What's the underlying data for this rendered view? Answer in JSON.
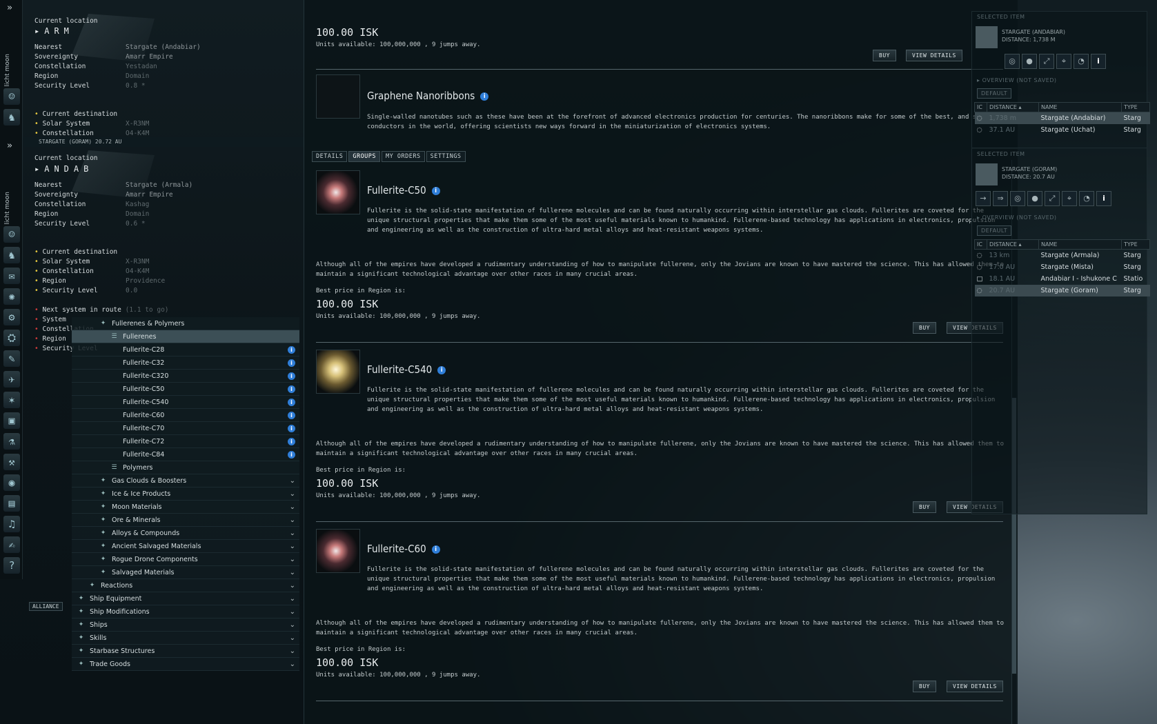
{
  "neocom": {
    "vertical_labels": [
      "licht moon",
      "licht moon"
    ],
    "icons": [
      "character-icon",
      "skills-icon",
      "mail-icon",
      "chat-icon",
      "market-icon",
      "industry-icon",
      "science-icon",
      "map-icon",
      "starmap-icon",
      "cargo-icon",
      "corporation-icon",
      "people-icon",
      "wallet-icon",
      "journal-icon",
      "fitting-icon",
      "notepad-icon",
      "help-icon"
    ]
  },
  "location_top": {
    "current_location_label": "Current location",
    "system_name": "ARM",
    "rows": [
      {
        "label": "Nearest",
        "value": "Stargate (Andabiar)"
      },
      {
        "label": "Sovereignty",
        "value": "Amarr Empire"
      },
      {
        "label": "Constellation",
        "value": "Yestadan"
      },
      {
        "label": "Region",
        "value": "Domain"
      },
      {
        "label": "Security Level",
        "value": "0.8 *"
      }
    ],
    "route": [
      {
        "label": "Current destination",
        "value": ""
      },
      {
        "label": "Solar System",
        "value": "X-R3NM"
      },
      {
        "label": "Constellation",
        "value": "O4-K4M"
      }
    ]
  },
  "location_bar": {
    "text": "STARGATE (GORAM)     20.72 AU"
  },
  "location_bottom": {
    "current_location_label": "Current location",
    "system_name": "ANDAB",
    "rows": [
      {
        "label": "Nearest",
        "value": "Stargate (Armala)"
      },
      {
        "label": "Sovereignty",
        "value": "Amarr Empire"
      },
      {
        "label": "Constellation",
        "value": "Kashag"
      },
      {
        "label": "Region",
        "value": "Domain"
      },
      {
        "label": "Security Level",
        "value": "0.6 *"
      }
    ],
    "route": [
      {
        "label": "Current destination",
        "value": ""
      },
      {
        "label": "Solar System",
        "value": "X-R3NM"
      },
      {
        "label": "Constellation",
        "value": "O4-K4M"
      },
      {
        "label": "Region",
        "value": "Providence"
      },
      {
        "label": "Security Level",
        "value": "0.0"
      }
    ],
    "next": [
      {
        "label": "Next system in route",
        "value": "(1.1 to go)"
      },
      {
        "label": "System",
        "value": ""
      },
      {
        "label": "Constellation",
        "value": ""
      },
      {
        "label": "Region",
        "value": ""
      },
      {
        "label": "Security Level",
        "value": ""
      }
    ]
  },
  "market_tree": {
    "items": [
      {
        "label": "Fullerenes & Polymers",
        "level": 2,
        "kind": "group"
      },
      {
        "label": "Fullerenes",
        "level": 3,
        "kind": "list",
        "selected": true
      },
      {
        "label": "Fullerite-C28",
        "level": 4,
        "kind": "item"
      },
      {
        "label": "Fullerite-C32",
        "level": 4,
        "kind": "item"
      },
      {
        "label": "Fullerite-C320",
        "level": 4,
        "kind": "item"
      },
      {
        "label": "Fullerite-C50",
        "level": 4,
        "kind": "item"
      },
      {
        "label": "Fullerite-C540",
        "level": 4,
        "kind": "item"
      },
      {
        "label": "Fullerite-C60",
        "level": 4,
        "kind": "item"
      },
      {
        "label": "Fullerite-C70",
        "level": 4,
        "kind": "item"
      },
      {
        "label": "Fullerite-C72",
        "level": 4,
        "kind": "item"
      },
      {
        "label": "Fullerite-C84",
        "level": 4,
        "kind": "item"
      },
      {
        "label": "Polymers",
        "level": 3,
        "kind": "list"
      },
      {
        "label": "Gas Clouds & Boosters",
        "level": 2,
        "kind": "group",
        "expandable": true
      },
      {
        "label": "Ice & Ice Products",
        "level": 2,
        "kind": "group",
        "expandable": true
      },
      {
        "label": "Moon Materials",
        "level": 2,
        "kind": "group",
        "expandable": true
      },
      {
        "label": "Ore & Minerals",
        "level": 2,
        "kind": "group",
        "expandable": true
      },
      {
        "label": "Alloys & Compounds",
        "level": 2,
        "kind": "group",
        "expandable": true
      },
      {
        "label": "Ancient Salvaged Materials",
        "level": 2,
        "kind": "group",
        "expandable": true
      },
      {
        "label": "Rogue Drone Components",
        "level": 2,
        "kind": "group",
        "expandable": true
      },
      {
        "label": "Salvaged Materials",
        "level": 2,
        "kind": "group",
        "expandable": true
      },
      {
        "label": "Reactions",
        "level": 1,
        "kind": "group",
        "expandable": true
      },
      {
        "label": "Ship Equipment",
        "level": 0,
        "kind": "group",
        "expandable": true
      },
      {
        "label": "Ship Modifications",
        "level": 0,
        "kind": "group",
        "expandable": true
      },
      {
        "label": "Ships",
        "level": 0,
        "kind": "group",
        "expandable": true
      },
      {
        "label": "Skills",
        "level": 0,
        "kind": "group",
        "expandable": true
      },
      {
        "label": "Starbase Structures",
        "level": 0,
        "kind": "group",
        "expandable": true
      },
      {
        "label": "Trade Goods",
        "level": 0,
        "kind": "group",
        "expandable": true
      }
    ]
  },
  "market_top": {
    "price": "100.00 ISK",
    "units": "Units available: 100,000,000 , 9 jumps away.",
    "buy": "BUY",
    "view_details": "VIEW DETAILS",
    "item_name": "Graphene Nanoribbons",
    "item_desc": "Single-walled nanotubes such as these have been at the forefront of advanced electronics production for centuries. The nanoribbons make for some of the best, and smallest, conductors in the world, offering scientists new ways forward in the miniaturization of electronics systems."
  },
  "tabs": [
    "DETAILS",
    "GROUPS",
    "MY ORDERS",
    "SETTINGS"
  ],
  "items": [
    {
      "name": "Fullerite-C50",
      "desc1": "Fullerite is the solid-state manifestation of fullerene molecules and can be found naturally occurring within interstellar gas clouds. Fullerites are coveted for the unique structural properties that make them some of the most useful materials known to humankind. Fullerene-based technology has applications in electronics, propulsion and engineering as well as the construction of ultra-hard metal alloys and heat-resistant weapons systems.",
      "desc2": "Although all of the empires have developed a rudimentary understanding of how to manipulate fullerene, only the Jovians are known to have mastered the science. This has allowed them to maintain a significant technological advantage over other races in many crucial areas.",
      "price_label": "Best price in Region is:",
      "price": "100.00 ISK",
      "units": "Units available: 100,000,000 , 9 jumps away.",
      "buy": "BUY",
      "view_details": "VIEW DETAILS"
    },
    {
      "name": "Fullerite-C540",
      "desc1": "Fullerite is the solid-state manifestation of fullerene molecules and can be found naturally occurring within interstellar gas clouds. Fullerites are coveted for the unique structural properties that make them some of the most useful materials known to humankind. Fullerene-based technology has applications in electronics, propulsion and engineering as well as the construction of ultra-hard metal alloys and heat-resistant weapons systems.",
      "desc2": "Although all of the empires have developed a rudimentary understanding of how to manipulate fullerene, only the Jovians are known to have mastered the science. This has allowed them to maintain a significant technological advantage over other races in many crucial areas.",
      "price_label": "Best price in Region is:",
      "price": "100.00 ISK",
      "units": "Units available: 100,000,000 , 9 jumps away.",
      "buy": "BUY",
      "view_details": "VIEW DETAILS"
    },
    {
      "name": "Fullerite-C60",
      "desc1": "Fullerite is the solid-state manifestation of fullerene molecules and can be found naturally occurring within interstellar gas clouds. Fullerites are coveted for the unique structural properties that make them some of the most useful materials known to humankind. Fullerene-based technology has applications in electronics, propulsion and engineering as well as the construction of ultra-hard metal alloys and heat-resistant weapons systems.",
      "desc2": "Although all of the empires have developed a rudimentary understanding of how to manipulate fullerene, only the Jovians are known to have mastered the science. This has allowed them to maintain a significant technological advantage over other races in many crucial areas.",
      "price_label": "Best price in Region is:",
      "price": "100.00 ISK",
      "units": "Units available: 100,000,000 , 9 jumps away.",
      "buy": "BUY",
      "view_details": "VIEW DETAILS"
    }
  ],
  "overview_top": {
    "selected_item": "SELECTED ITEM",
    "sel_name": "STARGATE (ANDABIAR)",
    "sel_dist": "DISTANCE: 1,738 M",
    "overview_title": "OVERVIEW (NOT SAVED)",
    "tab": "DEFAULT",
    "columns": [
      "IC",
      "DISTANCE",
      "NAME",
      "TYPE"
    ],
    "rows": [
      {
        "dist": "1,738 m",
        "name": "Stargate (Andabiar)",
        "type": "Starg"
      },
      {
        "dist": "37.1 AU",
        "name": "Stargate (Uchat)",
        "type": "Starg"
      }
    ]
  },
  "overview_bottom": {
    "selected_item": "SELECTED ITEM",
    "sel_name": "STARGATE (GORAM)",
    "sel_dist": "DISTANCE: 20.7 AU",
    "overview_title": "OVERVIEW (NOT SAVED)",
    "tab": "DEFAULT",
    "columns": [
      "IC",
      "DISTANCE",
      "NAME",
      "TYPE"
    ],
    "rows": [
      {
        "dist": "13 km",
        "name": "Stargate (Armala)",
        "type": "Starg"
      },
      {
        "dist": "17.0 AU",
        "name": "Stargate (Mista)",
        "type": "Starg"
      },
      {
        "dist": "18.1 AU",
        "name": "Andabiar I - Ishukone C",
        "type": "Statio"
      },
      {
        "dist": "20.7 AU",
        "name": "Stargate (Goram)",
        "type": "Starg"
      }
    ]
  },
  "chat": {
    "tab": "ALLIANCE"
  }
}
